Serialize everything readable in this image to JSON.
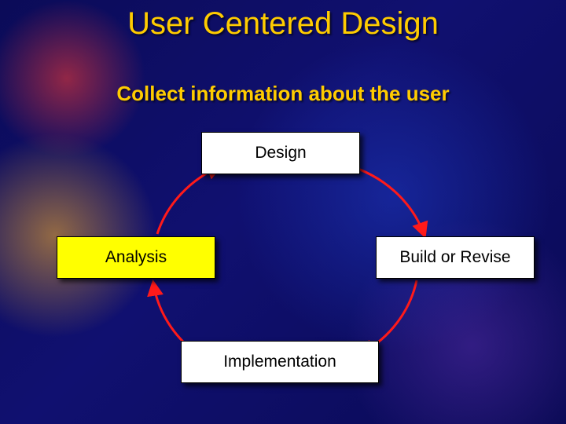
{
  "title": "User Centered Design",
  "subtitle": "Collect information about the user",
  "nodes": {
    "design": {
      "label": "Design"
    },
    "build": {
      "label": "Build or Revise"
    },
    "implementation": {
      "label": "Implementation"
    },
    "analysis": {
      "label": "Analysis"
    }
  },
  "cycle_order": [
    "design",
    "build",
    "implementation",
    "analysis"
  ],
  "colors": {
    "accent_text": "#ffcc00",
    "arrow": "#ff1a1a",
    "highlight_fill": "#ffff00",
    "node_fill": "#ffffff",
    "background": "#0a0a60"
  }
}
